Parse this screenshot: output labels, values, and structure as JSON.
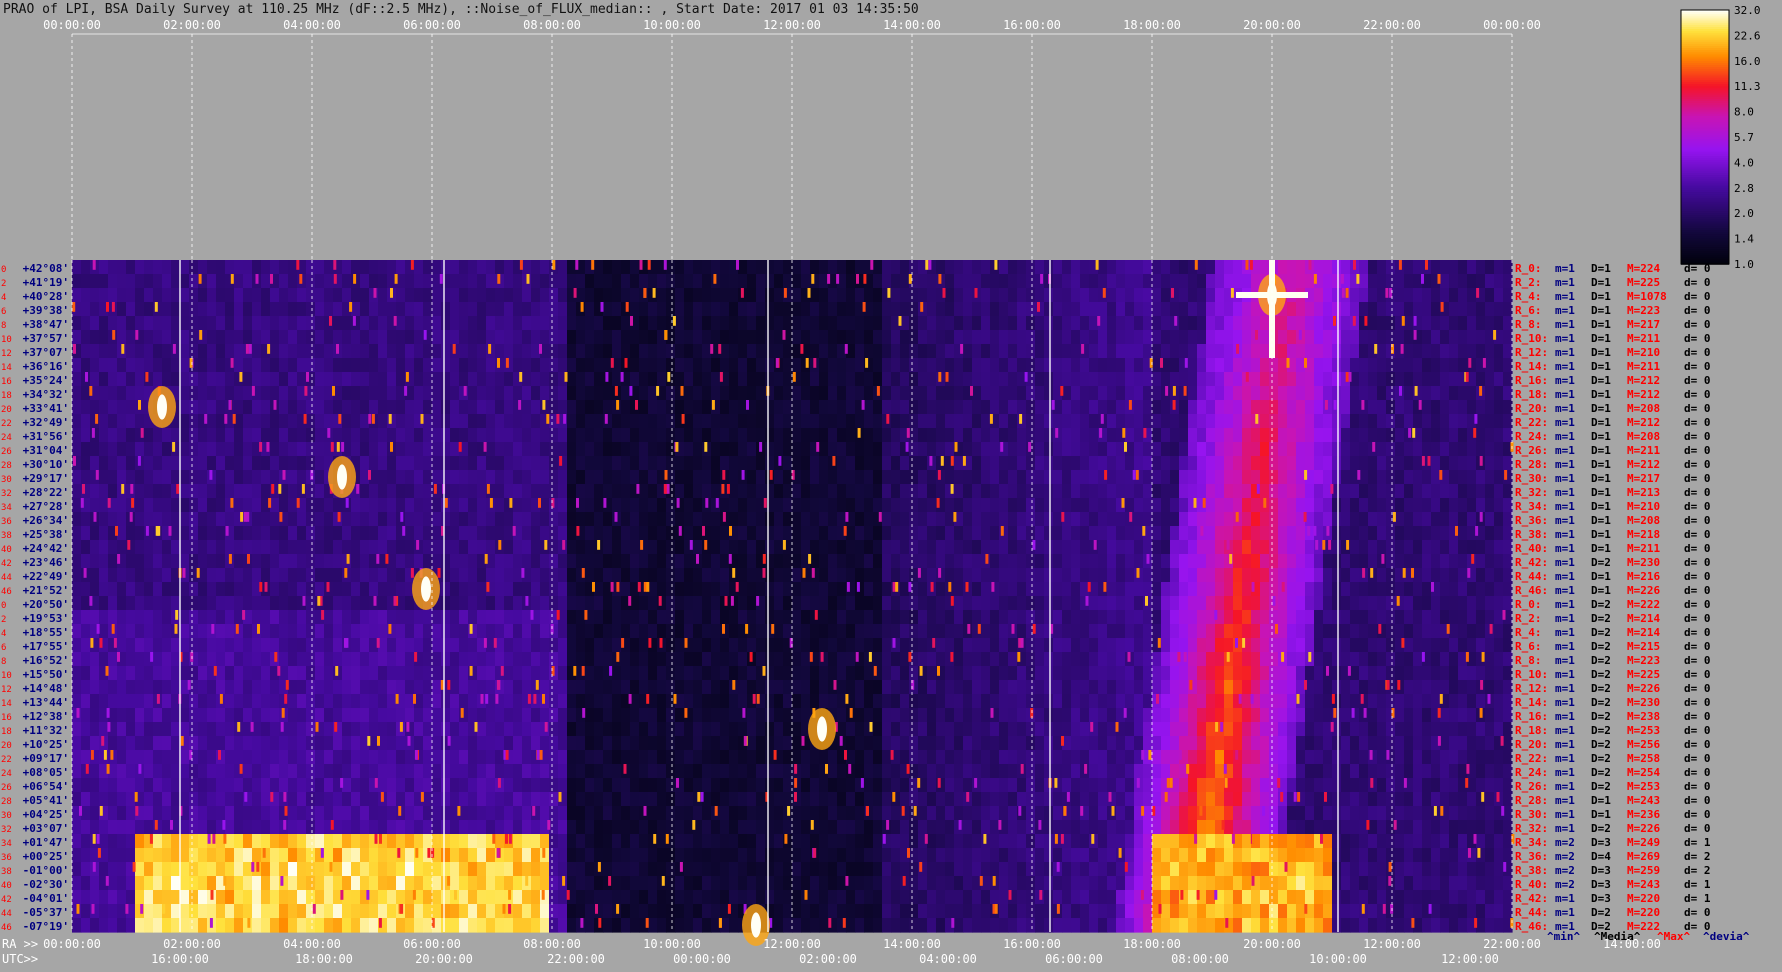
{
  "title": "PRAO of LPI, BSA Daily Survey at 110.25 MHz (dF::2.5 MHz), ::Noise_of_FLUX_median:: , Start Date: 2017 01 03 14:35:50",
  "chart_data": {
    "type": "heatmap",
    "title": "PRAO of LPI, BSA Daily Survey at 110.25 MHz (dF::2.5 MHz), ::Noise_of_FLUX_median:: , Start Date: 2017 01 03 14:35:50",
    "x_top_ticks": [
      "00:00:00",
      "02:00:00",
      "04:00:00",
      "06:00:00",
      "08:00:00",
      "10:00:00",
      "12:00:00",
      "14:00:00",
      "16:00:00",
      "18:00:00",
      "20:00:00",
      "22:00:00",
      "00:00:00"
    ],
    "ra_axis_label": "RA >>",
    "ra_ticks": [
      "00:00:00",
      "02:00:00",
      "04:00:00",
      "06:00:00",
      "08:00:00",
      "10:00:00",
      "12:00:00",
      "14:00:00",
      "16:00:00",
      "18:00:00",
      "20:00:00",
      "12:00:00",
      "22:00:00",
      "14:00:00"
    ],
    "utc_axis_label": "UTC>>",
    "utc_ticks": [
      "16:00:00",
      "18:00:00",
      "20:00:00",
      "22:00:00",
      "00:00:00",
      "02:00:00",
      "04:00:00",
      "06:00:00",
      "08:00:00",
      "10:00:00",
      "12:00:00"
    ],
    "row_index_labels": [
      "0",
      "2",
      "4",
      "6",
      "8",
      "10",
      "12",
      "14",
      "16",
      "18",
      "20",
      "22",
      "24",
      "26",
      "28",
      "30",
      "32",
      "34",
      "36",
      "38",
      "40",
      "42",
      "44",
      "46",
      "0",
      "2",
      "4",
      "6",
      "8",
      "10",
      "12",
      "14",
      "16",
      "18",
      "20",
      "22",
      "24",
      "26",
      "28",
      "30",
      "32",
      "34",
      "36",
      "38",
      "40",
      "42",
      "44",
      "46"
    ],
    "declinations": [
      "+42°08'",
      "+41°19'",
      "+40°28'",
      "+39°38'",
      "+38°47'",
      "+37°57'",
      "+37°07'",
      "+36°16'",
      "+35°24'",
      "+34°32'",
      "+33°41'",
      "+32°49'",
      "+31°56'",
      "+31°04'",
      "+30°10'",
      "+29°17'",
      "+28°22'",
      "+27°28'",
      "+26°34'",
      "+25°38'",
      "+24°42'",
      "+23°46'",
      "+22°49'",
      "+21°52'",
      "+20°50'",
      "+19°53'",
      "+18°55'",
      "+17°55'",
      "+16°52'",
      "+15°50'",
      "+14°48'",
      "+13°44'",
      "+12°38'",
      "+11°32'",
      "+10°25'",
      "+09°17'",
      "+08°05'",
      "+06°54'",
      "+05°41'",
      "+04°25'",
      "+03°07'",
      "+01°47'",
      "+00°25'",
      "-01°00'",
      "-02°30'",
      "-04°01'",
      "-05°37'",
      "-07°19'"
    ],
    "rows": [
      {
        "r": "R_0:",
        "m": "m=1",
        "D": "D=1",
        "M": "M=224",
        "d": "d= 0"
      },
      {
        "r": "R_2:",
        "m": "m=1",
        "D": "D=1",
        "M": "M=225",
        "d": "d= 0"
      },
      {
        "r": "R_4:",
        "m": "m=1",
        "D": "D=1",
        "M": "M=1078",
        "d": "d= 0"
      },
      {
        "r": "R_6:",
        "m": "m=1",
        "D": "D=1",
        "M": "M=223",
        "d": "d= 0"
      },
      {
        "r": "R_8:",
        "m": "m=1",
        "D": "D=1",
        "M": "M=217",
        "d": "d= 0"
      },
      {
        "r": "R_10:",
        "m": "m=1",
        "D": "D=1",
        "M": "M=211",
        "d": "d= 0"
      },
      {
        "r": "R_12:",
        "m": "m=1",
        "D": "D=1",
        "M": "M=210",
        "d": "d= 0"
      },
      {
        "r": "R_14:",
        "m": "m=1",
        "D": "D=1",
        "M": "M=211",
        "d": "d= 0"
      },
      {
        "r": "R_16:",
        "m": "m=1",
        "D": "D=1",
        "M": "M=212",
        "d": "d= 0"
      },
      {
        "r": "R_18:",
        "m": "m=1",
        "D": "D=1",
        "M": "M=212",
        "d": "d= 0"
      },
      {
        "r": "R_20:",
        "m": "m=1",
        "D": "D=1",
        "M": "M=208",
        "d": "d= 0"
      },
      {
        "r": "R_22:",
        "m": "m=1",
        "D": "D=1",
        "M": "M=212",
        "d": "d= 0"
      },
      {
        "r": "R_24:",
        "m": "m=1",
        "D": "D=1",
        "M": "M=208",
        "d": "d= 0"
      },
      {
        "r": "R_26:",
        "m": "m=1",
        "D": "D=1",
        "M": "M=211",
        "d": "d= 0"
      },
      {
        "r": "R_28:",
        "m": "m=1",
        "D": "D=1",
        "M": "M=212",
        "d": "d= 0"
      },
      {
        "r": "R_30:",
        "m": "m=1",
        "D": "D=1",
        "M": "M=217",
        "d": "d= 0"
      },
      {
        "r": "R_32:",
        "m": "m=1",
        "D": "D=1",
        "M": "M=213",
        "d": "d= 0"
      },
      {
        "r": "R_34:",
        "m": "m=1",
        "D": "D=1",
        "M": "M=210",
        "d": "d= 0"
      },
      {
        "r": "R_36:",
        "m": "m=1",
        "D": "D=1",
        "M": "M=208",
        "d": "d= 0"
      },
      {
        "r": "R_38:",
        "m": "m=1",
        "D": "D=1",
        "M": "M=218",
        "d": "d= 0"
      },
      {
        "r": "R_40:",
        "m": "m=1",
        "D": "D=1",
        "M": "M=211",
        "d": "d= 0"
      },
      {
        "r": "R_42:",
        "m": "m=1",
        "D": "D=2",
        "M": "M=230",
        "d": "d= 0"
      },
      {
        "r": "R_44:",
        "m": "m=1",
        "D": "D=1",
        "M": "M=216",
        "d": "d= 0"
      },
      {
        "r": "R_46:",
        "m": "m=1",
        "D": "D=1",
        "M": "M=226",
        "d": "d= 0"
      },
      {
        "r": "R_0:",
        "m": "m=1",
        "D": "D=2",
        "M": "M=222",
        "d": "d= 0"
      },
      {
        "r": "R_2:",
        "m": "m=1",
        "D": "D=2",
        "M": "M=214",
        "d": "d= 0"
      },
      {
        "r": "R_4:",
        "m": "m=1",
        "D": "D=2",
        "M": "M=214",
        "d": "d= 0"
      },
      {
        "r": "R_6:",
        "m": "m=1",
        "D": "D=2",
        "M": "M=215",
        "d": "d= 0"
      },
      {
        "r": "R_8:",
        "m": "m=1",
        "D": "D=2",
        "M": "M=223",
        "d": "d= 0"
      },
      {
        "r": "R_10:",
        "m": "m=1",
        "D": "D=2",
        "M": "M=225",
        "d": "d= 0"
      },
      {
        "r": "R_12:",
        "m": "m=1",
        "D": "D=2",
        "M": "M=226",
        "d": "d= 0"
      },
      {
        "r": "R_14:",
        "m": "m=1",
        "D": "D=2",
        "M": "M=230",
        "d": "d= 0"
      },
      {
        "r": "R_16:",
        "m": "m=1",
        "D": "D=2",
        "M": "M=238",
        "d": "d= 0"
      },
      {
        "r": "R_18:",
        "m": "m=1",
        "D": "D=2",
        "M": "M=253",
        "d": "d= 0"
      },
      {
        "r": "R_20:",
        "m": "m=1",
        "D": "D=2",
        "M": "M=256",
        "d": "d= 0"
      },
      {
        "r": "R_22:",
        "m": "m=1",
        "D": "D=2",
        "M": "M=258",
        "d": "d= 0"
      },
      {
        "r": "R_24:",
        "m": "m=1",
        "D": "D=2",
        "M": "M=254",
        "d": "d= 0"
      },
      {
        "r": "R_26:",
        "m": "m=1",
        "D": "D=2",
        "M": "M=253",
        "d": "d= 0"
      },
      {
        "r": "R_28:",
        "m": "m=1",
        "D": "D=1",
        "M": "M=243",
        "d": "d= 0"
      },
      {
        "r": "R_30:",
        "m": "m=1",
        "D": "D=1",
        "M": "M=236",
        "d": "d= 0"
      },
      {
        "r": "R_32:",
        "m": "m=1",
        "D": "D=2",
        "M": "M=226",
        "d": "d= 0"
      },
      {
        "r": "R_34:",
        "m": "m=2",
        "D": "D=3",
        "M": "M=249",
        "d": "d= 1"
      },
      {
        "r": "R_36:",
        "m": "m=2",
        "D": "D=4",
        "M": "M=269",
        "d": "d= 2"
      },
      {
        "r": "R_38:",
        "m": "m=2",
        "D": "D=3",
        "M": "M=259",
        "d": "d= 2"
      },
      {
        "r": "R_40:",
        "m": "m=2",
        "D": "D=3",
        "M": "M=243",
        "d": "d= 1"
      },
      {
        "r": "R_42:",
        "m": "m=1",
        "D": "D=3",
        "M": "M=220",
        "d": "d= 1"
      },
      {
        "r": "R_44:",
        "m": "m=1",
        "D": "D=2",
        "M": "M=220",
        "d": "d= 0"
      },
      {
        "r": "R_46:",
        "m": "m=1",
        "D": "D=2",
        "M": "M=222",
        "d": "d= 0"
      }
    ],
    "legend_bottom": [
      "^min^",
      "^Media^",
      "^Max^",
      "^devia^"
    ],
    "colorbar": {
      "ticks": [
        "32.0",
        "22.6",
        "16.0",
        "11.3",
        "8.0",
        "5.7",
        "4.0",
        "2.8",
        "2.0",
        "1.4",
        "1.0"
      ],
      "scale": "log",
      "range": [
        1.0,
        32.0
      ]
    },
    "colors": {
      "background": "#a6a6a6",
      "row_text": "#000080",
      "row_label": "#ff0000",
      "tick_text": "#ffffff",
      "row_index": "#ff0000"
    },
    "features": [
      {
        "kind": "band",
        "ra_hours": [
          1.0,
          8.0
        ],
        "rows": [
          41,
          47
        ],
        "level": 0.95
      },
      {
        "kind": "band",
        "ra_hours": [
          18.0,
          21.0
        ],
        "rows": [
          41,
          47
        ],
        "level": 0.9
      },
      {
        "kind": "plume",
        "ra_hours": [
          18.5,
          20.2
        ],
        "rows": [
          0,
          47
        ],
        "level": 0.75
      },
      {
        "kind": "source",
        "ra_hours": 20.0,
        "row": 2,
        "level": 1.0
      },
      {
        "kind": "source",
        "ra_hours": 12.5,
        "row": 33,
        "level": 0.95
      },
      {
        "kind": "source",
        "ra_hours": 5.9,
        "row": 23,
        "level": 0.95
      },
      {
        "kind": "source",
        "ra_hours": 4.5,
        "row": 15,
        "level": 0.9
      },
      {
        "kind": "source",
        "ra_hours": 1.5,
        "row": 10,
        "level": 0.9
      },
      {
        "kind": "source",
        "ra_hours": 11.4,
        "row": 47,
        "level": 0.95
      }
    ]
  }
}
